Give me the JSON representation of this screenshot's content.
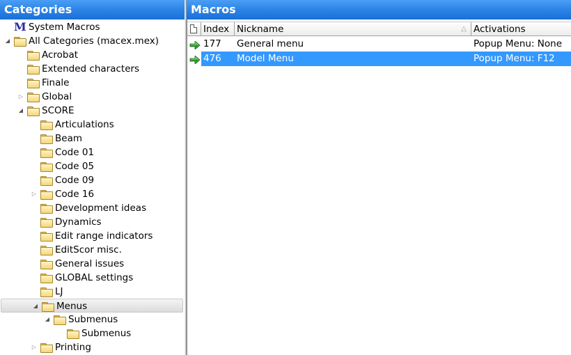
{
  "left_header": {
    "title": "Categories"
  },
  "right_header": {
    "title": "Macros"
  },
  "tree": [
    {
      "label": "System Macros",
      "icon": "m-logo-icon",
      "depth": 0,
      "expander": "none"
    },
    {
      "label": "All Categories (macex.mex)",
      "icon": "folder-icon",
      "depth": 0,
      "expander": "expanded"
    },
    {
      "label": "Acrobat",
      "icon": "folder-icon",
      "depth": 1,
      "expander": "none"
    },
    {
      "label": "Extended characters",
      "icon": "folder-icon",
      "depth": 1,
      "expander": "none"
    },
    {
      "label": "Finale",
      "icon": "folder-icon",
      "depth": 1,
      "expander": "none"
    },
    {
      "label": "Global",
      "icon": "folder-icon",
      "depth": 1,
      "expander": "collapsed"
    },
    {
      "label": "SCORE",
      "icon": "folder-icon",
      "depth": 1,
      "expander": "expanded"
    },
    {
      "label": "Articulations",
      "icon": "folder-icon",
      "depth": 2,
      "expander": "none"
    },
    {
      "label": "Beam",
      "icon": "folder-icon",
      "depth": 2,
      "expander": "none"
    },
    {
      "label": "Code 01",
      "icon": "folder-icon",
      "depth": 2,
      "expander": "none"
    },
    {
      "label": "Code 05",
      "icon": "folder-icon",
      "depth": 2,
      "expander": "none"
    },
    {
      "label": "Code 09",
      "icon": "folder-icon",
      "depth": 2,
      "expander": "none"
    },
    {
      "label": "Code 16",
      "icon": "folder-icon",
      "depth": 2,
      "expander": "collapsed"
    },
    {
      "label": "Development ideas",
      "icon": "folder-icon",
      "depth": 2,
      "expander": "none"
    },
    {
      "label": "Dynamics",
      "icon": "folder-icon",
      "depth": 2,
      "expander": "none"
    },
    {
      "label": "Edit range indicators",
      "icon": "folder-icon",
      "depth": 2,
      "expander": "none"
    },
    {
      "label": "EditScor misc.",
      "icon": "folder-icon",
      "depth": 2,
      "expander": "none"
    },
    {
      "label": "General issues",
      "icon": "folder-icon",
      "depth": 2,
      "expander": "none"
    },
    {
      "label": "GLOBAL settings",
      "icon": "folder-icon",
      "depth": 2,
      "expander": "none"
    },
    {
      "label": "LJ",
      "icon": "folder-icon",
      "depth": 2,
      "expander": "none"
    },
    {
      "label": "Menus",
      "icon": "folder-icon",
      "depth": 2,
      "expander": "expanded",
      "selected": true
    },
    {
      "label": "Submenus",
      "icon": "folder-icon",
      "depth": 3,
      "expander": "expanded"
    },
    {
      "label": "Submenus",
      "icon": "folder-icon",
      "depth": 4,
      "expander": "none"
    },
    {
      "label": "Printing",
      "icon": "folder-icon",
      "depth": 2,
      "expander": "collapsed"
    }
  ],
  "grid": {
    "columns": [
      {
        "key": "index",
        "label": "Index"
      },
      {
        "key": "nickname",
        "label": "Nickname",
        "sort": "ascending"
      },
      {
        "key": "activations",
        "label": "Activations"
      }
    ],
    "rows": [
      {
        "index": "177",
        "nickname": "General menu",
        "activations": "Popup Menu: None",
        "selected": false
      },
      {
        "index": "476",
        "nickname": "Model Menu",
        "activations": "Popup Menu: F12",
        "selected": true
      }
    ]
  },
  "colors": {
    "header_blue": "#2e86e8",
    "selection_blue": "#3399ff",
    "arrow_green": "#2e9a2e",
    "m_icon": "#2b2b9a"
  }
}
